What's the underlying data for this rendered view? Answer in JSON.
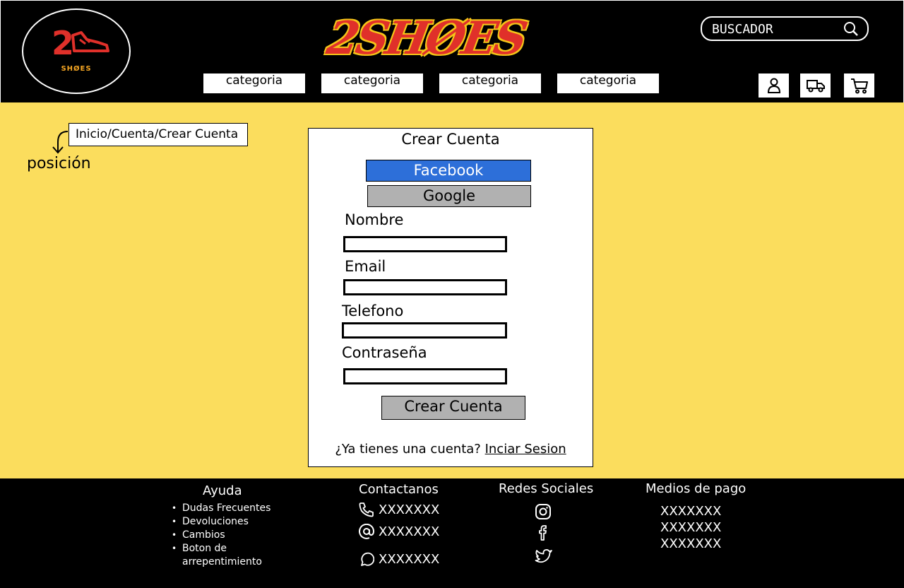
{
  "header": {
    "logo_number": "2",
    "logo_tagline": "SHØES",
    "brand": "2SHØES",
    "search": {
      "placeholder": "BUSCADOR"
    },
    "categories": [
      "categoria",
      "categoria",
      "categoria",
      "categoria"
    ],
    "icons": [
      "user-icon",
      "truck-icon",
      "cart-icon"
    ]
  },
  "main": {
    "breadcrumb": "Inicio/Cuenta/Crear Cuenta",
    "position_label": "posición",
    "form": {
      "title": "Crear Cuenta",
      "facebook_label": "Facebook",
      "google_label": "Google",
      "fields": [
        {
          "label": "Nombre",
          "value": ""
        },
        {
          "label": "Email",
          "value": ""
        },
        {
          "label": "Telefono",
          "value": ""
        },
        {
          "label": "Contraseña",
          "value": ""
        }
      ],
      "submit_label": "Crear Cuenta",
      "login_prompt": "¿Ya tienes una cuenta?",
      "login_link": "Inciar Sesion"
    }
  },
  "footer": {
    "help": {
      "title": "Ayuda",
      "items": [
        "Dudas Frecuentes",
        "Devoluciones",
        "Cambios",
        "Boton de",
        "arrepentimiento"
      ]
    },
    "contact": {
      "title": "Contactanos",
      "items": [
        {
          "icon": "phone-icon",
          "text": "XXXXXXX"
        },
        {
          "icon": "at-icon",
          "text": "XXXXXXX"
        },
        {
          "icon": "chat-icon",
          "text": "XXXXXXX"
        }
      ]
    },
    "social": {
      "title": "Redes Sociales",
      "icons": [
        "instagram-icon",
        "facebook-icon",
        "twitter-icon"
      ]
    },
    "payment": {
      "title": "Medios de pago",
      "items": [
        "XXXXXXX",
        "XXXXXXX",
        "XXXXXXX"
      ]
    }
  },
  "colors": {
    "header_bg": "#000000",
    "main_bg": "#fbdd5d",
    "facebook": "#2d6fd9",
    "button_grey": "#b1b1b1",
    "brand_red": "#e0302a",
    "brand_yellow": "#f5c518"
  }
}
